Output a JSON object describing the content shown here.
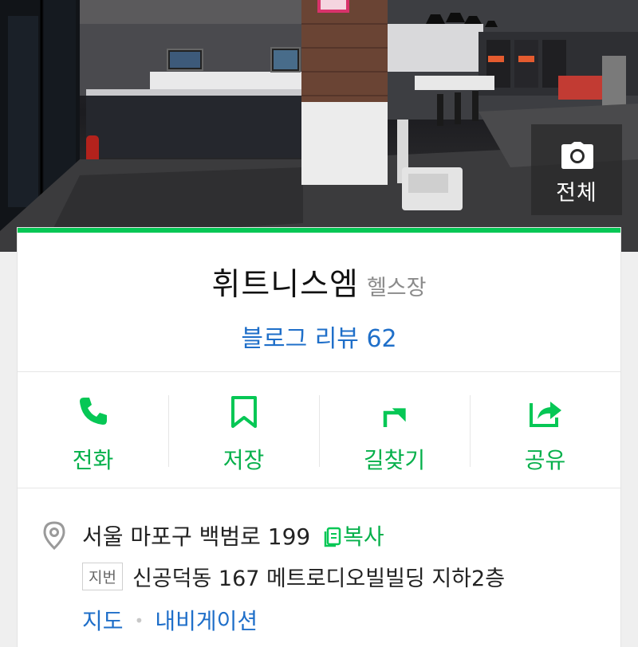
{
  "hero": {
    "photo_button_label": "전체",
    "icons": [
      "camera-icon"
    ]
  },
  "place": {
    "name": "휘트니스엠",
    "category": "헬스장",
    "blog_review_label": "블로그 리뷰 62"
  },
  "actions": [
    {
      "label": "전화",
      "icon": "phone-icon"
    },
    {
      "label": "저장",
      "icon": "bookmark-icon"
    },
    {
      "label": "길찾기",
      "icon": "directions-icon"
    },
    {
      "label": "공유",
      "icon": "share-icon"
    }
  ],
  "address": {
    "road": "서울 마포구 백범로 199",
    "copy_label": "복사",
    "jibun_badge": "지번",
    "jibun": "신공덕동 167 메트로디오빌빌딩 지하2층",
    "map_link": "지도",
    "navigation_link": "내비게이션"
  },
  "colors": {
    "accent_green": "#06c755",
    "link_blue": "#1f6fc9",
    "category_gray": "#8a8a8a"
  }
}
